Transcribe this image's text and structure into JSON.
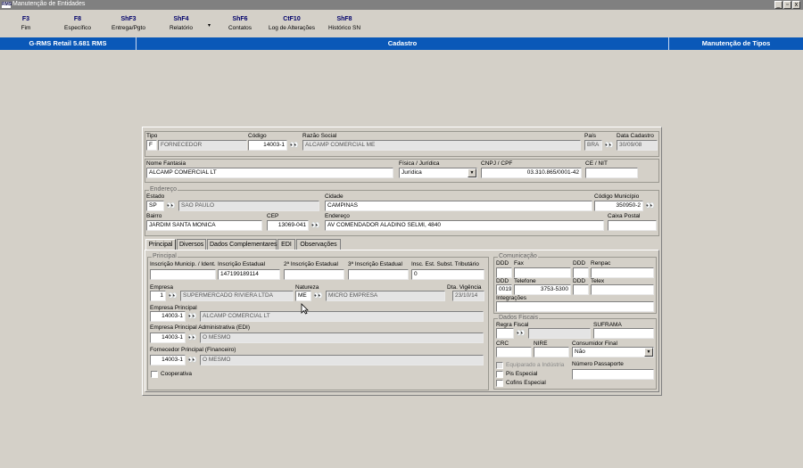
{
  "window": {
    "title": "Manutenção de Entidades",
    "app_icon": "app-icon",
    "buttons": [
      "_",
      "▫",
      "x"
    ]
  },
  "toolbar": {
    "keys": [
      {
        "key": "F3",
        "label": "Fim"
      },
      {
        "key": "F8",
        "label": "Específico"
      },
      {
        "key": "ShF3",
        "label": "Entrega/Pgto"
      },
      {
        "key": "ShF4",
        "label": "Relatório"
      },
      {
        "key": "ShF6",
        "label": "Contatos"
      },
      {
        "key": "CtF10",
        "label": "Log de Alterações"
      },
      {
        "key": "ShF8",
        "label": "Histórico SN"
      }
    ],
    "dropdown_arrow": "▾"
  },
  "header": {
    "app_name": "G-RMS Retail 5.681 RMS",
    "section": "Cadastro",
    "module": "Manutenção de Tipos"
  },
  "main": {
    "tipo": {
      "label": "Tipo",
      "code": "F",
      "desc": "FORNECEDOR"
    },
    "codigo": {
      "label": "Código",
      "value": "14003-1"
    },
    "razao": {
      "label": "Razão Social",
      "value": "ALCAMP COMERCIAL ME"
    },
    "pais": {
      "label": "País",
      "value": "BRA"
    },
    "data_cadastro": {
      "label": "Data Cadastro",
      "value": "30/09/08"
    },
    "fantasia": {
      "label": "Nome Fantasia",
      "value": "ALCAMP COMERCIAL LT"
    },
    "fisjur": {
      "label": "Física / Jurídica",
      "value": "Jurídica"
    },
    "cnpj": {
      "label": "CNPJ / CPF",
      "value": "03.310.865/0001-42"
    },
    "cenit": {
      "label": "CE / NIT",
      "value": ""
    },
    "endereco": {
      "title": "Endereço",
      "estado_label": "Estado",
      "estado_uf": "SP",
      "estado_nome": "SAO PAULO",
      "cidade_label": "Cidade",
      "cidade": "CAMPINAS",
      "mun_label": "Código Município",
      "mun": "350950-2",
      "bairro_label": "Bairro",
      "bairro": "JARDIM SANTA MONICA",
      "cep_label": "CEP",
      "cep": "13069-041",
      "end_label": "Endereço",
      "end": "AV COMENDADOR ALADINO SELMI, 4840",
      "cxpostal_label": "Caixa Postal",
      "cxpostal": ""
    },
    "tabs": [
      "Principal",
      "Diversos",
      "Dados Complementares",
      "EDI",
      "Observações"
    ],
    "principal": {
      "title": "Principal",
      "insc_mun_label": "Inscrição Municip. / Ident.",
      "insc_est_label": "Inscrição Estadual",
      "insc_est": "147199189114",
      "insc2_label": "2ª Inscrição Estadual",
      "insc3_label": "3ª Inscrição Estadual",
      "insc_st_label": "Insc. Est. Subst. Tributário",
      "insc_st": "0",
      "empresa_label": "Empresa",
      "empresa_code": "1",
      "empresa_nome": "SUPERMERCADO RIVIERA LTDA",
      "natureza_label": "Natureza",
      "natureza_code": "ME",
      "natureza_nome": "MICRO EMPRESA",
      "vigencia_label": "Dta. Vigência",
      "vigencia": "23/10/14",
      "emp_princ_label": "Empresa Principal",
      "emp_princ_code": "14003-1",
      "emp_princ_nome": "ALCAMP COMERCIAL LT",
      "emp_adm_label": "Empresa Principal Administrativa (EDI)",
      "emp_adm_code": "14003-1",
      "emp_adm_nome": "O MESMO",
      "forn_label": "Fornecedor Principal (Financeiro)",
      "forn_code": "14003-1",
      "forn_nome": "O MESMO",
      "coop_label": "Cooperativa"
    },
    "comunicacao": {
      "title": "Comunicação",
      "ddd": "DDD",
      "fax": "Fax",
      "renpac": "Renpac",
      "telefone": "Telefone",
      "telefone_ddd": "0019",
      "telefone_val": "3753-5300",
      "telex": "Telex",
      "integracoes": "Integrações"
    },
    "fiscais": {
      "title": "Dados Fiscais",
      "regra_label": "Regra Fiscal",
      "suframa_label": "SUFRAMA",
      "crc_label": "CRC",
      "nire_label": "NIRE",
      "consumidor_label": "Consumidor Final",
      "consumidor": "Não",
      "equip_label": "Equiparado a Indústria",
      "passaporte_label": "Número Passaporte",
      "pis_label": "Pis Especial",
      "cofins_label": "Cofins Especial"
    }
  }
}
